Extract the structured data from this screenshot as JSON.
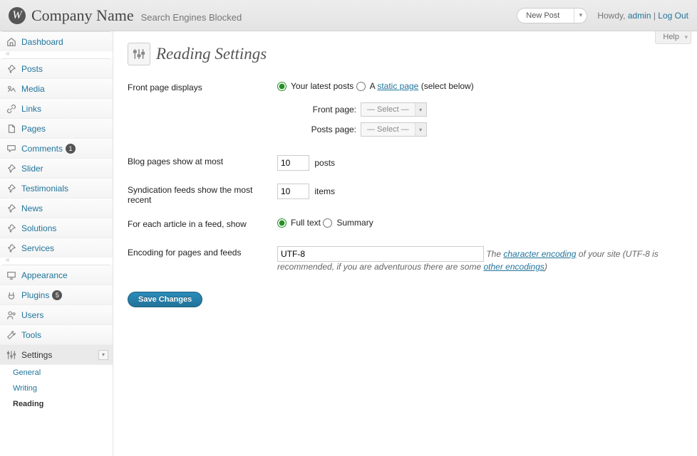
{
  "header": {
    "site_name": "Company Name",
    "tagline": "Search Engines Blocked",
    "fav_action": "New Post",
    "howdy": "Howdy,",
    "user": "admin",
    "logout": "Log Out",
    "help": "Help"
  },
  "sidebar": {
    "groups": [
      {
        "type": "item",
        "id": "dashboard",
        "label": "Dashboard",
        "icon": "home"
      },
      {
        "type": "sep"
      },
      {
        "type": "item",
        "id": "posts",
        "label": "Posts",
        "icon": "pin"
      },
      {
        "type": "item",
        "id": "media",
        "label": "Media",
        "icon": "media"
      },
      {
        "type": "item",
        "id": "links",
        "label": "Links",
        "icon": "link"
      },
      {
        "type": "item",
        "id": "pages",
        "label": "Pages",
        "icon": "page"
      },
      {
        "type": "item",
        "id": "comments",
        "label": "Comments",
        "icon": "comment",
        "count": "1"
      },
      {
        "type": "item",
        "id": "slider",
        "label": "Slider",
        "icon": "pin"
      },
      {
        "type": "item",
        "id": "testimonials",
        "label": "Testimonials",
        "icon": "pin"
      },
      {
        "type": "item",
        "id": "news",
        "label": "News",
        "icon": "pin"
      },
      {
        "type": "item",
        "id": "solutions",
        "label": "Solutions",
        "icon": "pin"
      },
      {
        "type": "item",
        "id": "services",
        "label": "Services",
        "icon": "pin"
      },
      {
        "type": "sep"
      },
      {
        "type": "item",
        "id": "appearance",
        "label": "Appearance",
        "icon": "appearance"
      },
      {
        "type": "item",
        "id": "plugins",
        "label": "Plugins",
        "icon": "plugin",
        "count": "5"
      },
      {
        "type": "item",
        "id": "users",
        "label": "Users",
        "icon": "users"
      },
      {
        "type": "item",
        "id": "tools",
        "label": "Tools",
        "icon": "tools"
      },
      {
        "type": "item",
        "id": "settings",
        "label": "Settings",
        "icon": "settings",
        "open": true,
        "sub": [
          {
            "label": "General"
          },
          {
            "label": "Writing"
          },
          {
            "label": "Reading",
            "current": true
          }
        ]
      }
    ]
  },
  "reading": {
    "title": "Reading Settings",
    "rows": {
      "front_page": {
        "th": "Front page displays",
        "opt_latest": "Your latest posts",
        "opt_static_a": "A ",
        "opt_static_link": "static page",
        "opt_static_b": " (select below)",
        "sub_front": "Front page:",
        "sub_posts": "Posts page:",
        "select_placeholder": "— Select —"
      },
      "blog_pages": {
        "th": "Blog pages show at most",
        "value": "10",
        "suffix": "posts"
      },
      "syndication": {
        "th": "Syndication feeds show the most recent",
        "value": "10",
        "suffix": "items"
      },
      "feed_show": {
        "th": "For each article in a feed, show",
        "opt_full": "Full text",
        "opt_summary": "Summary"
      },
      "encoding": {
        "th": "Encoding for pages and feeds",
        "value": "UTF-8",
        "desc_a": "The ",
        "desc_link1": "character encoding",
        "desc_b": " of your site (UTF-8 is recommended, if you are adventurous there are some ",
        "desc_link2": "other encodings",
        "desc_c": ")"
      }
    },
    "submit": "Save Changes"
  }
}
